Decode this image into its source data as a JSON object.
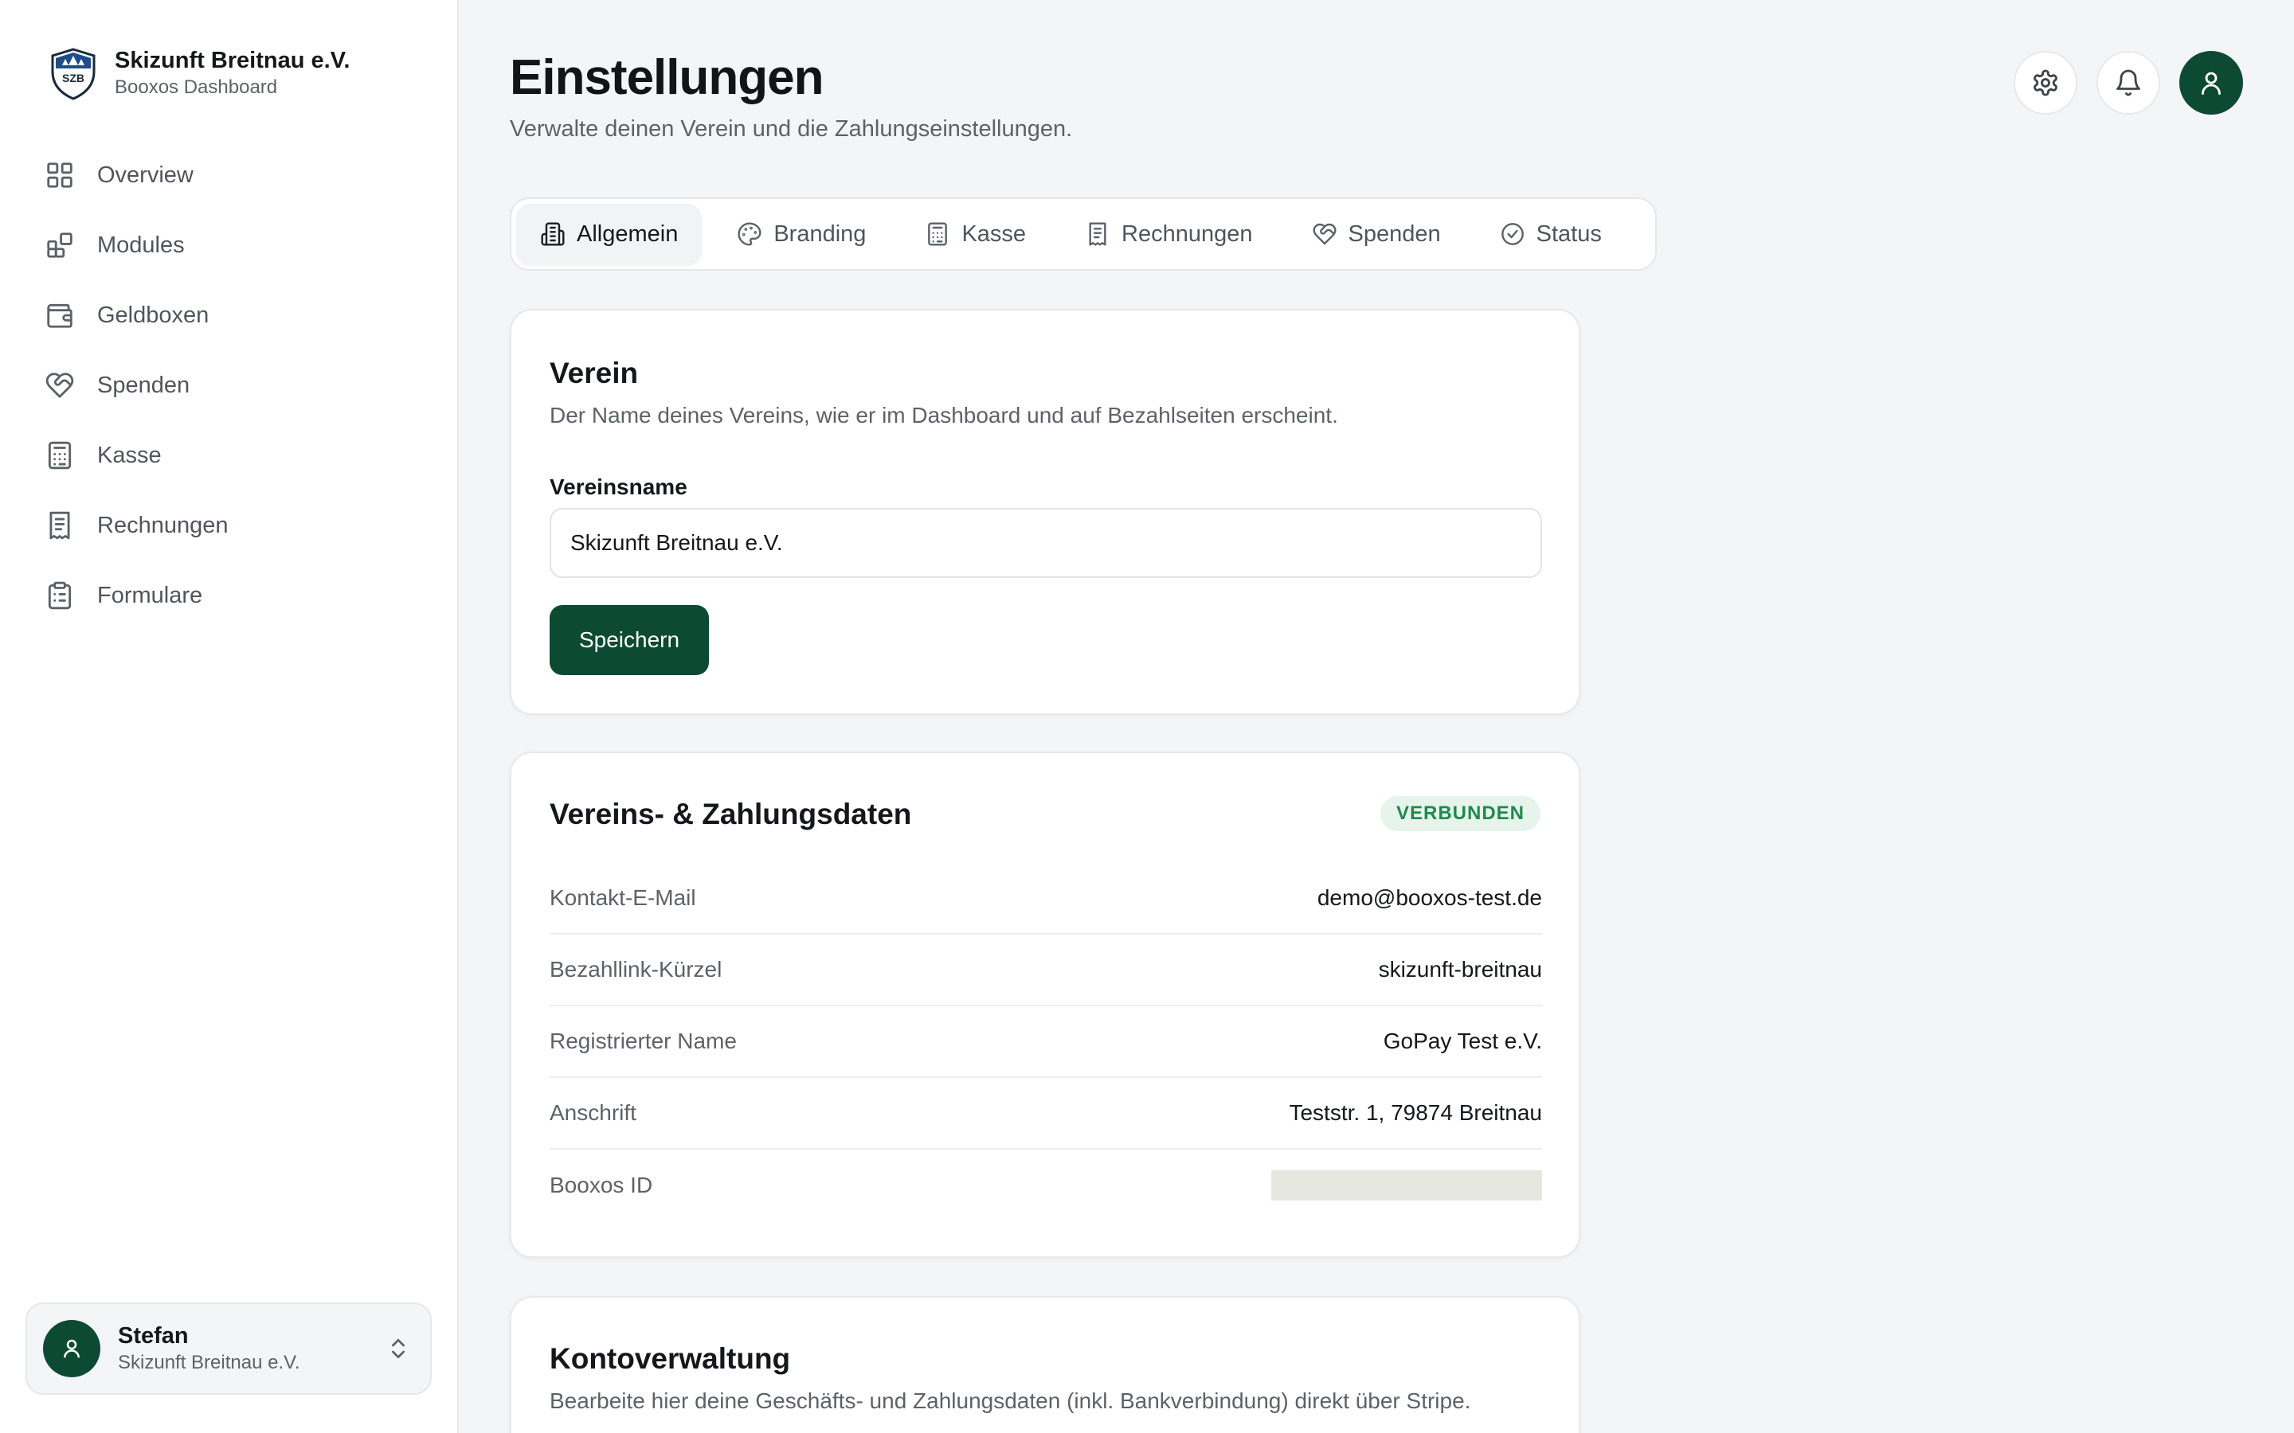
{
  "sidebar": {
    "brand": {
      "name": "Skizunft Breitnau e.V.",
      "subtitle": "Booxos Dashboard",
      "logo_text": "SZB"
    },
    "items": [
      {
        "label": "Overview",
        "icon": "grid-icon"
      },
      {
        "label": "Modules",
        "icon": "modules-icon"
      },
      {
        "label": "Geldboxen",
        "icon": "wallet-icon"
      },
      {
        "label": "Spenden",
        "icon": "heart-handshake-icon"
      },
      {
        "label": "Kasse",
        "icon": "calculator-icon"
      },
      {
        "label": "Rechnungen",
        "icon": "receipt-icon"
      },
      {
        "label": "Formulare",
        "icon": "clipboard-list-icon"
      }
    ],
    "user": {
      "name": "Stefan",
      "org": "Skizunft Breitnau e.V."
    }
  },
  "header": {
    "title": "Einstellungen",
    "subtitle": "Verwalte deinen Verein und die Zahlungseinstellungen."
  },
  "tabs": [
    {
      "label": "Allgemein",
      "icon": "building-icon",
      "active": true
    },
    {
      "label": "Branding",
      "icon": "palette-icon",
      "active": false
    },
    {
      "label": "Kasse",
      "icon": "calculator-icon",
      "active": false
    },
    {
      "label": "Rechnungen",
      "icon": "receipt-icon",
      "active": false
    },
    {
      "label": "Spenden",
      "icon": "heart-handshake-icon",
      "active": false
    },
    {
      "label": "Status",
      "icon": "check-circle-icon",
      "active": false
    }
  ],
  "verein": {
    "title": "Verein",
    "description": "Der Name deines Vereins, wie er im Dashboard und auf Bezahlseiten erscheint.",
    "field_label": "Vereinsname",
    "field_value": "Skizunft Breitnau e.V.",
    "save_label": "Speichern"
  },
  "daten": {
    "title": "Vereins- & Zahlungsdaten",
    "badge": "VERBUNDEN",
    "rows": [
      {
        "label": "Kontakt-E-Mail",
        "value": "demo@booxos-test.de"
      },
      {
        "label": "Bezahllink-Kürzel",
        "value": "skizunft-breitnau"
      },
      {
        "label": "Registrierter Name",
        "value": "GoPay Test e.V."
      },
      {
        "label": "Anschrift",
        "value": "Teststr. 1, 79874 Breitnau"
      },
      {
        "label": "Booxos ID",
        "value": ""
      }
    ]
  },
  "konto": {
    "title": "Kontoverwaltung",
    "description": "Bearbeite hier deine Geschäfts- und Zahlungsdaten (inkl. Bankverbindung) direkt über Stripe."
  },
  "colors": {
    "accent": "#0d4a34",
    "badge_bg": "#e6f4ec",
    "badge_text": "#1f8a4c",
    "page_bg": "#f4f5f6"
  }
}
